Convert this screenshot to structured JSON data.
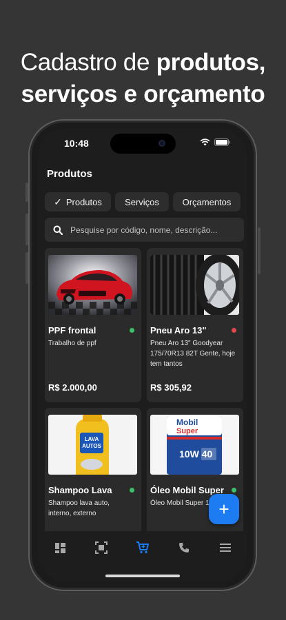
{
  "headline": {
    "light": "Cadastro de ",
    "bold1": "produtos,",
    "bold2": "serviços e orçamento"
  },
  "status_bar": {
    "time": "10:48",
    "icons": [
      "wifi-icon",
      "battery-icon"
    ]
  },
  "screen_title": "Produtos",
  "tabs": [
    {
      "label": "Produtos",
      "selected": true,
      "icon": "check-icon"
    },
    {
      "label": "Serviços",
      "selected": false
    },
    {
      "label": "Orçamentos",
      "selected": false
    }
  ],
  "search": {
    "placeholder": "Pesquise por código, nome, descrição..."
  },
  "products": [
    {
      "name": "PPF frontal",
      "description": "Trabalho de ppf",
      "price": "R$ 2.000,00",
      "status_color": "#3bc06a",
      "image": "red-car-photo"
    },
    {
      "name": "Pneu Aro 13\"",
      "description": "Pneu Aro 13\" Goodyear 175/70R13 82T Gente, hoje tem tantos",
      "price": "R$ 305,92",
      "status_color": "#e0494b",
      "image": "tire-photo"
    },
    {
      "name": "Shampoo Lava",
      "description": "Shampoo lava auto, interno, externo",
      "price": "",
      "status_color": "#3bc06a",
      "image": "shampoo-bottle-photo"
    },
    {
      "name": "Óleo Mobil Super",
      "description": "Óleo Mobil Super 1",
      "price": "",
      "status_color": "#3bc06a",
      "image": "oil-can-photo",
      "brand": "Mobil",
      "brand_sub": "Super",
      "grade": "10W 40"
    }
  ],
  "fab": {
    "label": "+"
  },
  "bottom_nav": [
    {
      "icon": "dashboard-icon",
      "active": false
    },
    {
      "icon": "scan-icon",
      "active": false
    },
    {
      "icon": "cart-icon",
      "active": true
    },
    {
      "icon": "phone-icon",
      "active": false
    },
    {
      "icon": "menu-icon",
      "active": false
    }
  ],
  "colors": {
    "accent": "#1e7cf2",
    "background": "#353535",
    "screen": "#1d1d1d",
    "card": "#2b2b2b"
  }
}
